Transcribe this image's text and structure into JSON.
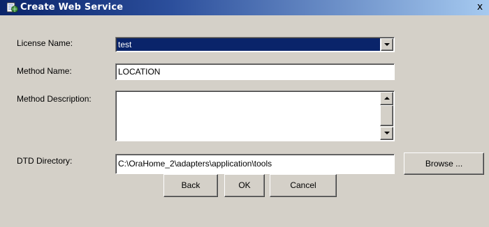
{
  "window": {
    "title": "Create Web Service",
    "icon": "web-service-app-icon",
    "close_glyph": "x"
  },
  "form": {
    "license_name": {
      "label": "License Name:",
      "value": "test",
      "icon": "chevron-down-icon"
    },
    "method_name": {
      "label": "Method Name:",
      "value": "LOCATION"
    },
    "method_description": {
      "label": "Method Description:",
      "value": ""
    },
    "dtd_directory": {
      "label": "DTD Directory:",
      "value": "C:\\OraHome_2\\adapters\\application\\tools"
    }
  },
  "buttons": {
    "browse": "Browse ...",
    "back": "Back",
    "ok": "OK",
    "cancel": "Cancel"
  },
  "colors": {
    "dialog_bg": "#d4d0c8",
    "title_bar": "#0a246a",
    "selection": "#0a246a"
  }
}
